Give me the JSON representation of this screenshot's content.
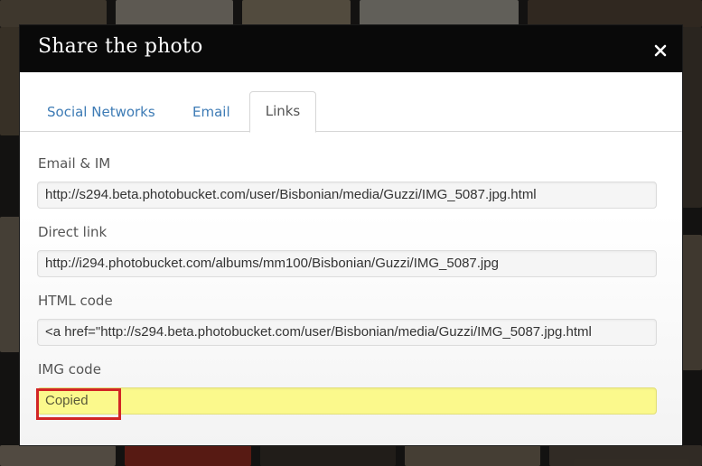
{
  "dialog": {
    "title": "Share the photo",
    "close_label": "×"
  },
  "tabs": [
    {
      "label": "Social Networks",
      "active": false
    },
    {
      "label": "Email",
      "active": false
    },
    {
      "label": "Links",
      "active": true
    }
  ],
  "fields": [
    {
      "label": "Email & IM",
      "value": "http://s294.beta.photobucket.com/user/Bisbonian/media/Guzzi/IMG_5087.jpg.html"
    },
    {
      "label": "Direct link",
      "value": "http://i294.photobucket.com/albums/mm100/Bisbonian/Guzzi/IMG_5087.jpg"
    },
    {
      "label": "HTML code",
      "value": "<a href=\"http://s294.beta.photobucket.com/user/Bisbonian/media/Guzzi/IMG_5087.jpg.html"
    },
    {
      "label": "IMG code",
      "value": "Copied"
    }
  ],
  "colors": {
    "header_bg": "#090909",
    "tab_link": "#3d7bb5",
    "copied_bg": "#fbf98c",
    "highlight": "#d22525"
  }
}
